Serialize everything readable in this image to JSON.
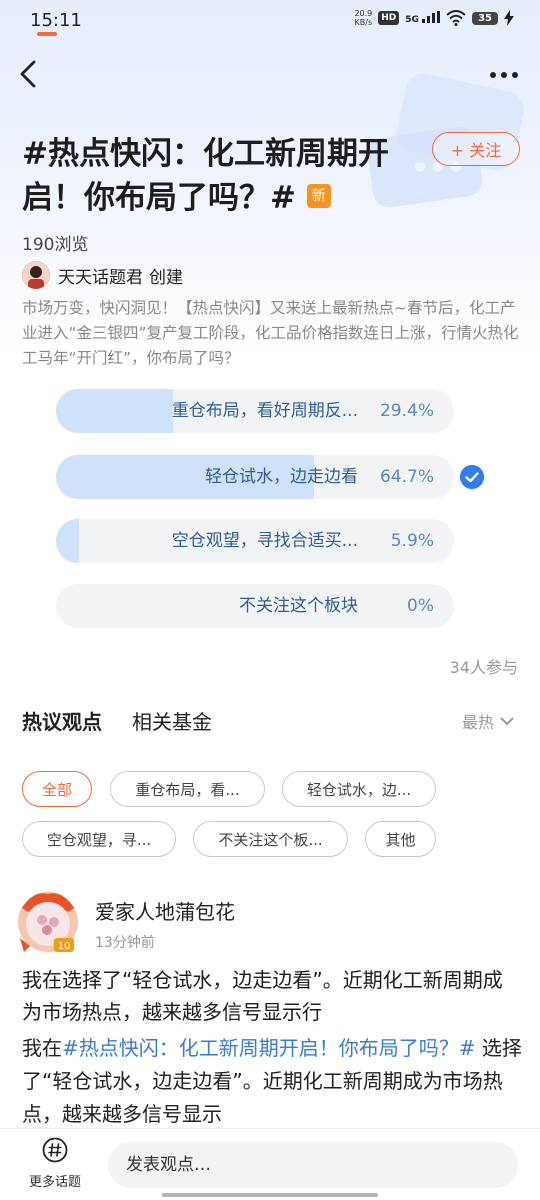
{
  "status_bar": {
    "time": "15:11",
    "net_speed_value": "20.9",
    "net_speed_unit": "KB/s",
    "hd_label": "HD",
    "signal_label": "5G",
    "battery": "35"
  },
  "header": {
    "title": "#热点快闪：化工新周期开启！你布局了吗？#",
    "new_badge": "新",
    "follow_label": "+ 关注",
    "views": "190浏览",
    "creator_name": "天天话题君",
    "creator_action": "创建",
    "description": "市场万变，快闪洞见！【热点快闪】又来送上最新热点~春节后，化工产业进入“金三银四”复产复工阶段，化工品价格指数连日上涨，行情火热化工马年“开门红”，你布局了吗？"
  },
  "poll": {
    "options": [
      {
        "label": "重仓布局，看好周期反...",
        "percent_text": "29.4%",
        "fraction": 0.294,
        "selected": false
      },
      {
        "label": "轻仓试水，边走边看",
        "percent_text": "64.7%",
        "fraction": 0.647,
        "selected": true
      },
      {
        "label": "空仓观望，寻找合适买...",
        "percent_text": "5.9%",
        "fraction": 0.059,
        "selected": false
      },
      {
        "label": "不关注这个板块",
        "percent_text": "0%",
        "fraction": 0,
        "selected": false
      }
    ],
    "participants": "34人参与",
    "accent_color": "#2d7ff0",
    "fill_color": "#cfe2fb"
  },
  "tabs": {
    "items": [
      "热议观点",
      "相关基金"
    ],
    "active_index": 0,
    "sort_label": "最热"
  },
  "filters": {
    "chips": [
      "全部",
      "重仓布局，看...",
      "轻仓试水，边...",
      "空仓观望，寻...",
      "不关注这个板...",
      "其他"
    ],
    "active_index": 0
  },
  "post": {
    "author": "爱家人地蒲包花",
    "time": "13分钟前",
    "headline": "我在选择了“轻仓试水，边走边看”。近期化工新周期成为市场热点，越来越多信号显示行",
    "body_prefix": "我在",
    "body_topic": "#热点快闪：化工新周期开启！你布局了吗？#",
    "body_suffix": " 选择了“轻仓试水，边走边看”。近期化工新周期成为市场热点，越来越多信号显示"
  },
  "bottom_bar": {
    "more_topics_label": "更多话题",
    "comment_placeholder": "发表观点…"
  },
  "colors": {
    "brand_orange": "#f06a3a",
    "new_badge": "#f7931e",
    "link_blue": "#3a7bd5"
  }
}
